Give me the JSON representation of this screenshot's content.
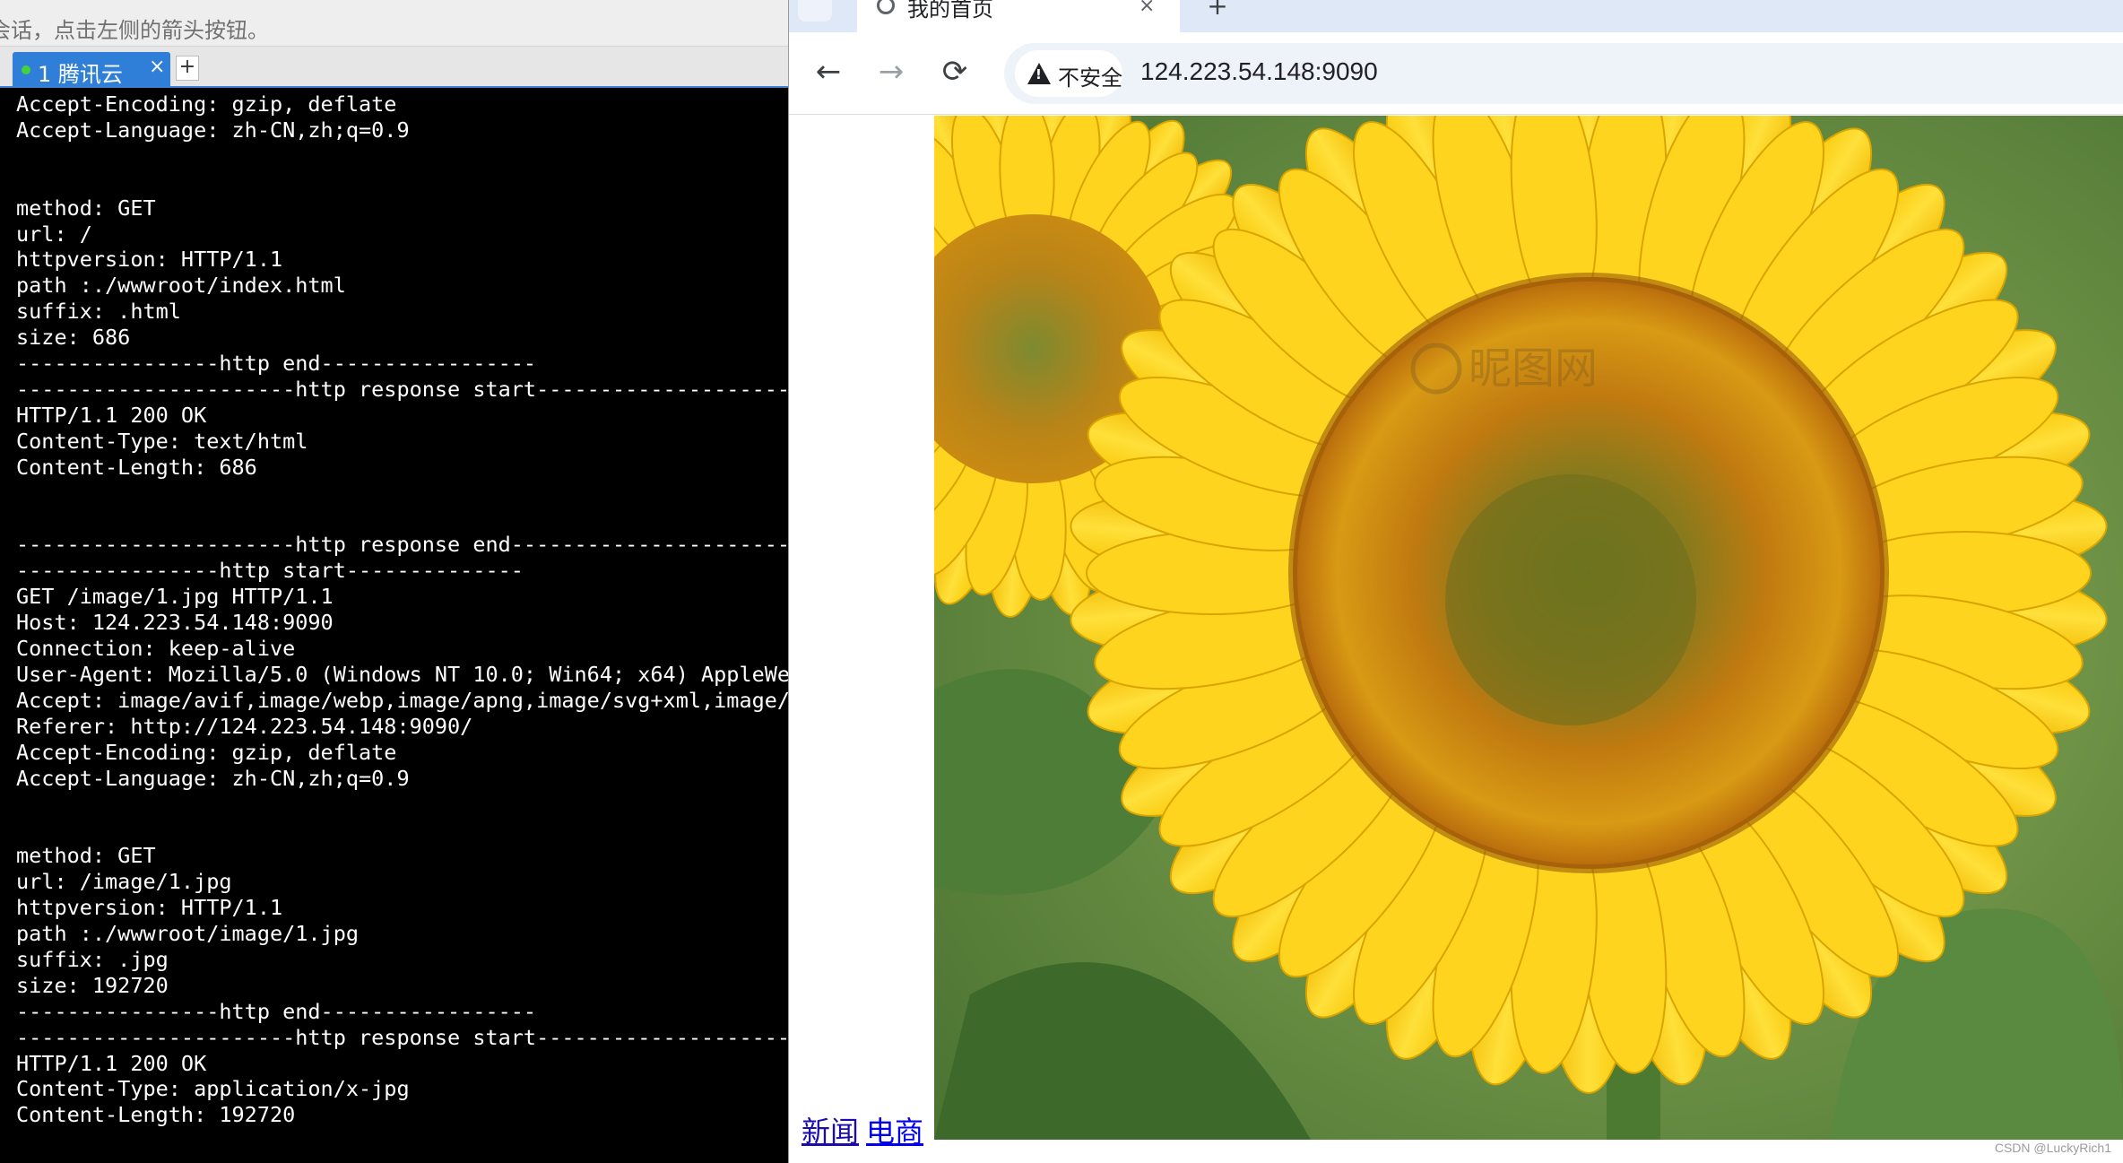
{
  "terminal": {
    "hint_text": "会话，点击左侧的箭头按钮。",
    "tab_label": "1 腾讯云",
    "close_glyph": "×",
    "add_tab_glyph": "+",
    "output": "Accept-Encoding: gzip, deflate\nAccept-Language: zh-CN,zh;q=0.9\n\n\nmethod: GET\nurl: /\nhttpversion: HTTP/1.1\npath :./wwwroot/index.html\nsuffix: .html\nsize: 686\n----------------http end-----------------\n----------------------http response start------------------------\nHTTP/1.1 200 OK\nContent-Type: text/html\nContent-Length: 686\n\n\n----------------------http response end------------------------\n----------------http start--------------\nGET /image/1.jpg HTTP/1.1\nHost: 124.223.54.148:9090\nConnection: keep-alive\nUser-Agent: Mozilla/5.0 (Windows NT 10.0; Win64; x64) AppleWebKit\nAccept: image/avif,image/webp,image/apng,image/svg+xml,image/*\nReferer: http://124.223.54.148:9090/\nAccept-Encoding: gzip, deflate\nAccept-Language: zh-CN,zh;q=0.9\n\n\nmethod: GET\nurl: /image/1.jpg\nhttpversion: HTTP/1.1\npath :./wwwroot/image/1.jpg\nsuffix: .jpg\nsize: 192720\n----------------http end-----------------\n----------------------http response start------------------------\nHTTP/1.1 200 OK\nContent-Type: application/x-jpg\nContent-Length: 192720"
  },
  "browser": {
    "tab_title": "我的首页",
    "tab_close": "×",
    "new_tab": "+",
    "back": "←",
    "forward": "→",
    "reload": "⟳",
    "security_label": "不安全",
    "url": "124.223.54.148:9090",
    "page": {
      "links": [
        "新闻",
        "电商"
      ],
      "image_alt": "sunflower",
      "watermark_logo_text": "昵图网",
      "footer_watermark": "CSDN @LuckyRich1"
    }
  },
  "colors": {
    "terminal_bg": "#000000",
    "terminal_text": "#ffffff",
    "tab_active": "#2f7fd8",
    "link": "#1a0dab",
    "petal": "#ffd21a",
    "disk_outer": "#b8860b",
    "disk_inner": "#6b6a1d",
    "leaf": "#4f7a3a"
  },
  "icons": [
    "warning-icon",
    "back-arrow-icon",
    "forward-arrow-icon",
    "reload-icon",
    "close-icon",
    "plus-icon",
    "globe-favicon-icon"
  ]
}
